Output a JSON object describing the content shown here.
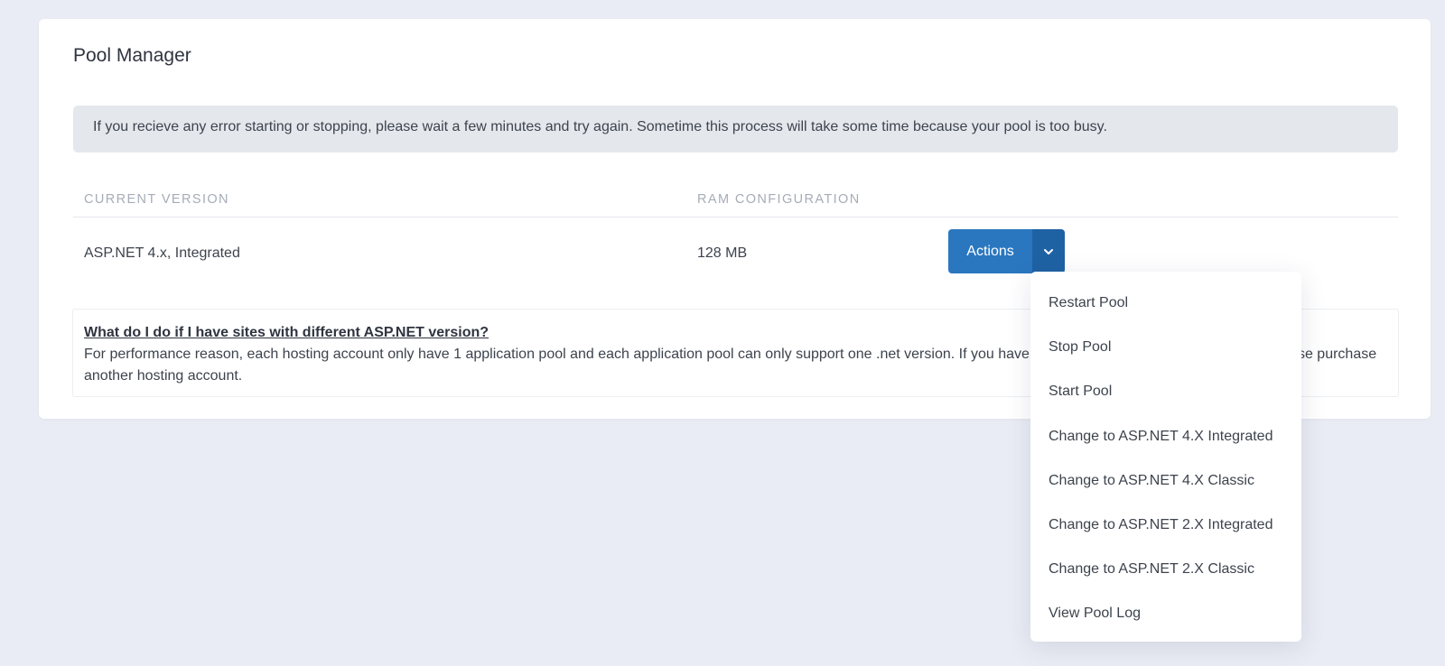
{
  "card": {
    "title": "Pool Manager"
  },
  "alert": {
    "text": "If you recieve any error starting or stopping, please wait a few minutes and try again. Sometime this process will take some time because your pool is too busy."
  },
  "table": {
    "headers": {
      "version": "CURRENT VERSION",
      "ram": "RAM CONFIGURATION"
    },
    "row": {
      "version": "ASP.NET 4.x, Integrated",
      "ram": "128 MB"
    }
  },
  "actions": {
    "label": "Actions",
    "toggle_icon": "chevron-down-icon",
    "menu": [
      "Restart Pool",
      "Stop Pool",
      "Start Pool",
      "Change to ASP.NET 4.X Integrated",
      "Change to ASP.NET 4.X Classic",
      "Change to ASP.NET 2.X Integrated",
      "Change to ASP.NET 2.X Classic",
      "View Pool Log"
    ]
  },
  "info": {
    "question": "What do I do if I have sites with different ASP.NET version?",
    "answer": "For performance reason, each hosting account only have 1 application pool and each application pool can only support one .net version. If you have sites with different ASP.NET version, please purchase another hosting account."
  },
  "colors": {
    "background": "#e9ecf4",
    "primary_button": "#2a77c0",
    "primary_button_dark": "#1f62a4",
    "alert_background": "#e4e8ed"
  }
}
